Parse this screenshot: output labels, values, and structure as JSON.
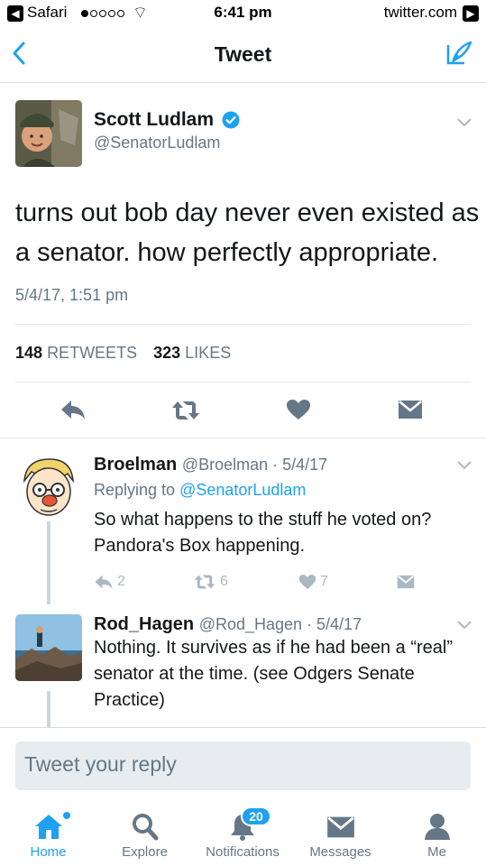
{
  "status_bar": {
    "back_app": "Safari",
    "back_glyph": "◀",
    "wifi_glyph": "⌔",
    "time": "6:41 pm",
    "domain": "twitter.com",
    "fwd_glyph": "▶"
  },
  "nav": {
    "title": "Tweet",
    "back_icon": "chevron-left-icon",
    "compose_icon": "compose-tweet-icon"
  },
  "colors": {
    "accent": "#1da1f2",
    "text_secondary": "#657786",
    "action_icon": "#657786",
    "muted_icon": "#aab8c2"
  },
  "main_tweet": {
    "author_name": "Scott Ludlam",
    "handle": "@SenatorLudlam",
    "verified_icon": "verified-badge-icon",
    "text": "turns out bob day never even existed as a senator. how perfectly appropriate.",
    "date": "5/4/17, 1:51 pm",
    "retweets_count": "148",
    "retweets_label": "RETWEETS",
    "likes_count": "323",
    "likes_label": "LIKES"
  },
  "replies": [
    {
      "name": "Broelman",
      "handle_meta": "@Broelman · 5/4/17",
      "replying_prefix": "Replying to",
      "replying_to": "@SenatorLudlam",
      "text": "So what happens to the stuff he voted on? Pandora's Box happening.",
      "reply_count": "2",
      "retweet_count": "6",
      "like_count": "7"
    },
    {
      "name": "Rod_Hagen",
      "handle_meta": "@Rod_Hagen · 5/4/17",
      "text": "Nothing. It survives as if he had been a “real” senator at the time. (see Odgers Senate Practice)"
    }
  ],
  "composer": {
    "placeholder": "Tweet your reply"
  },
  "tabbar": {
    "tabs": [
      {
        "label": "Home",
        "icon": "home-icon",
        "active": true
      },
      {
        "label": "Explore",
        "icon": "search-icon"
      },
      {
        "label": "Notifications",
        "icon": "bell-icon",
        "badge": "20"
      },
      {
        "label": "Messages",
        "icon": "envelope-icon"
      },
      {
        "label": "Me",
        "icon": "person-icon"
      }
    ]
  }
}
